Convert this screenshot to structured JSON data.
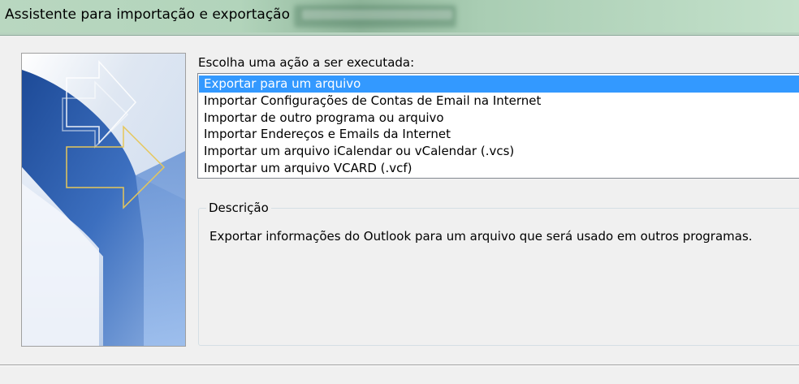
{
  "window": {
    "title": "Assistente para importação e exportação"
  },
  "wizard": {
    "prompt": "Escolha uma ação a ser executada:",
    "actions": [
      "Exportar para um arquivo",
      "Importar Configurações de Contas de Email na Internet",
      "Importar de outro programa ou arquivo",
      "Importar Endereços e Emails da Internet",
      "Importar um arquivo iCalendar ou vCalendar (.vcs)",
      "Importar um arquivo VCARD (.vcf)"
    ],
    "selected_index": 0,
    "description": {
      "legend": "Descrição",
      "text": "Exportar informações do Outlook para um arquivo que será usado em outros programas."
    }
  },
  "colors": {
    "selection": "#3399ff",
    "banner_blue": "#2f5fa8",
    "arrow_outline": "#e6c75a"
  }
}
